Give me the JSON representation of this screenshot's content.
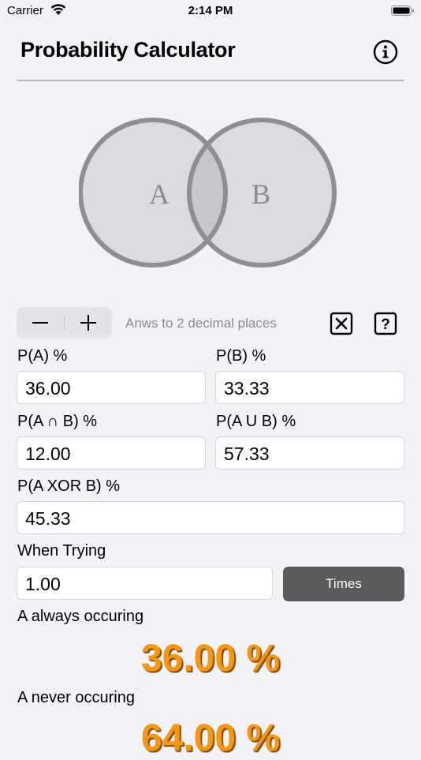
{
  "status_bar": {
    "carrier": "Carrier",
    "time": "2:14 PM"
  },
  "header": {
    "title": "Probability Calculator"
  },
  "venn": {
    "label_a": "A",
    "label_b": "B"
  },
  "controls": {
    "decimal_hint": "Anws to 2 decimal places",
    "minus_symbol": "−",
    "plus_symbol": "+",
    "help_symbol": "?"
  },
  "fields": {
    "pa_label": "P(A) %",
    "pa_value": "36.00",
    "pb_label": "P(B) %",
    "pb_value": "33.33",
    "pab_label": "P(A ∩ B) %",
    "pab_value": "12.00",
    "paub_label": "P(A U B) %",
    "paub_value": "57.33",
    "pxor_label": "P(A XOR B) %",
    "pxor_value": "45.33",
    "trying_label": "When Trying",
    "trying_value": "1.00",
    "times_label": "Times"
  },
  "results": {
    "always_label": "A always occuring",
    "always_value": "36.00 %",
    "never_label": "A never occuring",
    "never_value": "64.00 %"
  },
  "colors": {
    "accent": "#f5980e",
    "button_dark": "#5a5a5a",
    "background": "#f2f2f7"
  }
}
